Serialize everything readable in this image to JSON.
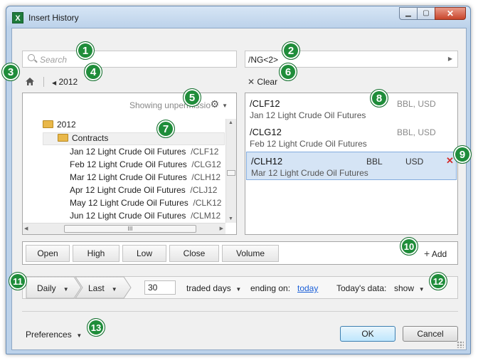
{
  "window": {
    "title": "Insert History",
    "app_icon": "excel-icon"
  },
  "search": {
    "placeholder": "Search"
  },
  "symbol_input": {
    "value": "/NG<2>"
  },
  "nav": {
    "year": "2012"
  },
  "clear": {
    "label": "Clear"
  },
  "tree_panel": {
    "status": "Showing unpermissio",
    "rows": [
      {
        "label": "2012",
        "type": "folder"
      },
      {
        "label": "Contracts",
        "type": "folder"
      },
      {
        "label": "Jan 12 Light Crude Oil Futures",
        "symbol": "/CLF12"
      },
      {
        "label": "Feb 12 Light Crude Oil Futures",
        "symbol": "/CLG12"
      },
      {
        "label": "Mar 12 Light Crude Oil Futures",
        "symbol": "/CLH12"
      },
      {
        "label": "Apr 12 Light Crude Oil Futures",
        "symbol": "/CLJ12"
      },
      {
        "label": "May 12 Light Crude Oil Futures",
        "symbol": "/CLK12"
      },
      {
        "label": "Jun 12 Light Crude Oil Futures",
        "symbol": "/CLM12"
      }
    ],
    "hscroll_grip": "III"
  },
  "selected_list": [
    {
      "ticker": "/CLF12",
      "desc": "Jan 12 Light Crude Oil Futures",
      "units": "BBL, USD"
    },
    {
      "ticker": "/CLG12",
      "desc": "Feb 12 Light Crude Oil Futures",
      "units": "BBL, USD"
    },
    {
      "ticker": "/CLH12",
      "desc": "Mar 12 Light Crude Oil Futures",
      "unit1": "BBL",
      "unit2": "USD",
      "remove": "✕"
    }
  ],
  "fields": [
    "Open",
    "High",
    "Low",
    "Close",
    "Volume"
  ],
  "add": {
    "label": "Add"
  },
  "period": {
    "frequency": "Daily",
    "anchor": "Last",
    "count": "30",
    "unit": "traded days",
    "ending_label": "ending on:",
    "ending_value": "today",
    "todays_label": "Today's data:",
    "todays_value": "show"
  },
  "preferences": {
    "label": "Preferences"
  },
  "buttons": {
    "ok": "OK",
    "cancel": "Cancel"
  },
  "badges": [
    "1",
    "2",
    "3",
    "4",
    "5",
    "6",
    "7",
    "8",
    "9",
    "10",
    "11",
    "12",
    "13"
  ],
  "colors": {
    "badge": "#1f8d3a",
    "remove": "#d42a2a",
    "selection": "#d5e4f5"
  }
}
